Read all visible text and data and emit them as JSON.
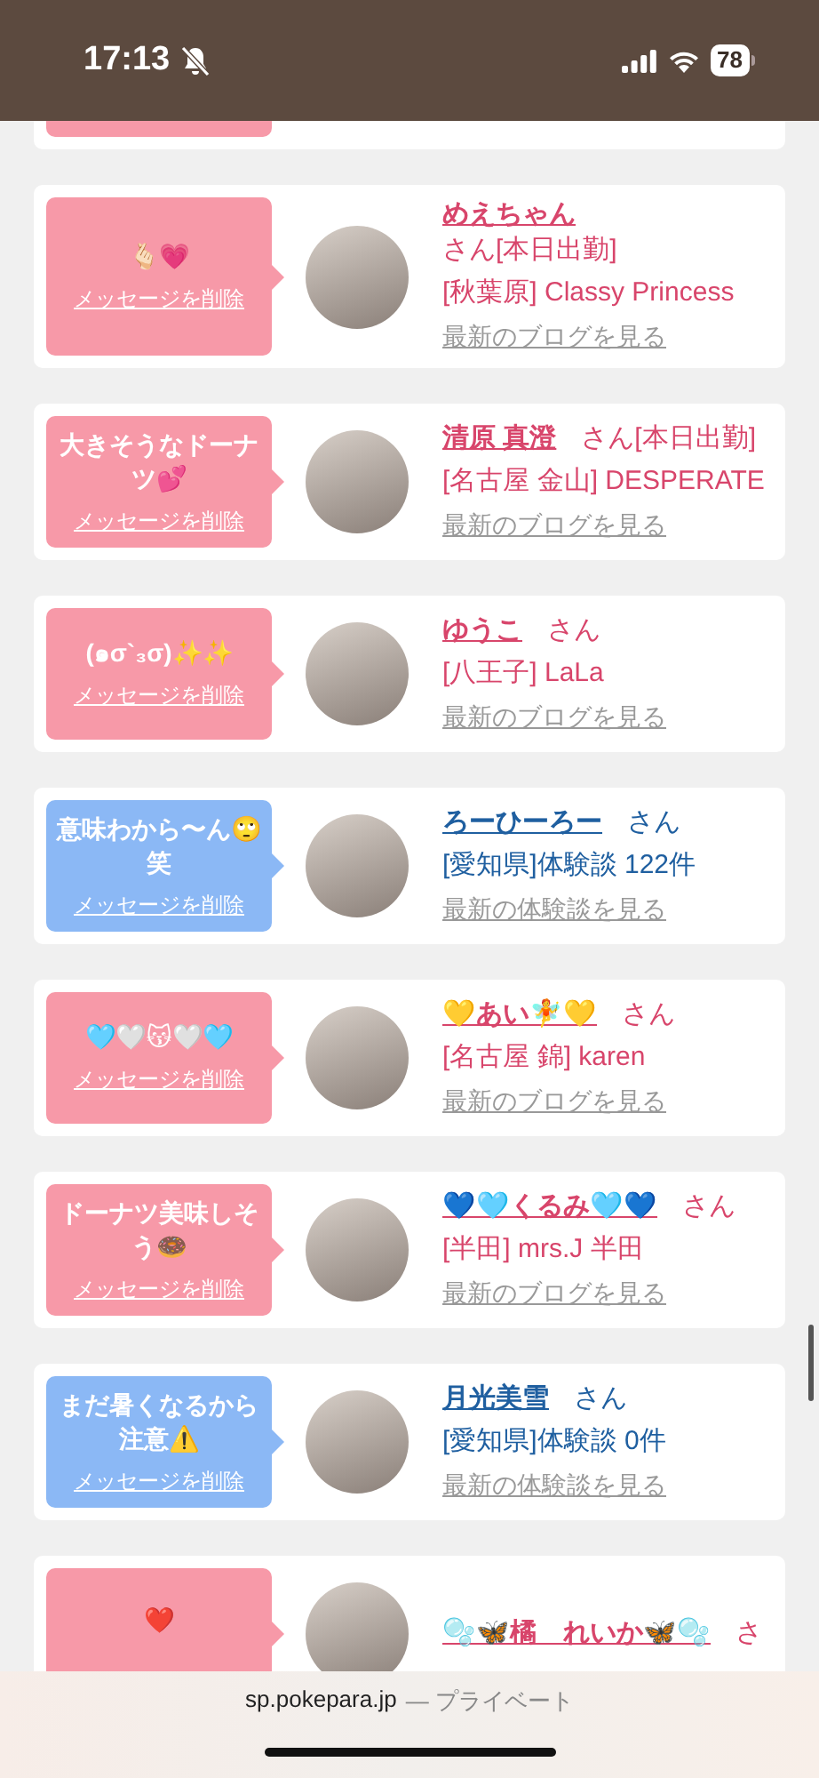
{
  "status_bar": {
    "time": "17:13",
    "battery": "78"
  },
  "messages": [
    {
      "kind": "cast",
      "message": "🫰🏻💗",
      "delete_label": "メッセージを削除",
      "name": "めえちゃん",
      "honorific": "さん[本日出勤]",
      "info": "[秋葉原] Classy Princess",
      "link": "最新のブログを見る"
    },
    {
      "kind": "cast",
      "message": "大きそうなドーナツ💕",
      "delete_label": "メッセージを削除",
      "name": "清原 真澄",
      "honorific": "さん[本日出勤]",
      "info": "[名古屋 金山] DESPERATE",
      "link": "最新のブログを見る"
    },
    {
      "kind": "cast",
      "message": "(๑σ`₃σ)✨✨",
      "delete_label": "メッセージを削除",
      "name": "ゆうこ",
      "honorific": "さん",
      "info": "[八王子] LaLa",
      "link": "最新のブログを見る"
    },
    {
      "kind": "member",
      "message": "意味わから〜ん🙄笑",
      "delete_label": "メッセージを削除",
      "name": "ろーひーろー",
      "honorific": "さん",
      "info": "[愛知県]体験談 122件",
      "link": "最新の体験談を見る"
    },
    {
      "kind": "cast",
      "message": "🩵🤍😽🤍🩵",
      "delete_label": "メッセージを削除",
      "name": "💛あい🧚💛",
      "honorific": "さん",
      "info": "[名古屋 錦] karen",
      "link": "最新のブログを見る"
    },
    {
      "kind": "cast",
      "message": "ドーナツ美味しそう🍩",
      "delete_label": "メッセージを削除",
      "name": "💙🩵くるみ🩵💙",
      "honorific": "さん",
      "info": "[半田] mrs.J 半田",
      "link": "最新のブログを見る"
    },
    {
      "kind": "member",
      "message": "まだ暑くなるから注意⚠️",
      "delete_label": "メッセージを削除",
      "name": "月光美雪",
      "honorific": "さん",
      "info": "[愛知県]体験談 0件",
      "link": "最新の体験談を見る"
    },
    {
      "kind": "cast",
      "message": "❤️",
      "name": "🫧🦋橘　れいか🦋🫧",
      "honorific": "さ"
    }
  ],
  "browser_bar": {
    "domain": "sp.pokepara.jp",
    "mode": "— プライベート"
  }
}
